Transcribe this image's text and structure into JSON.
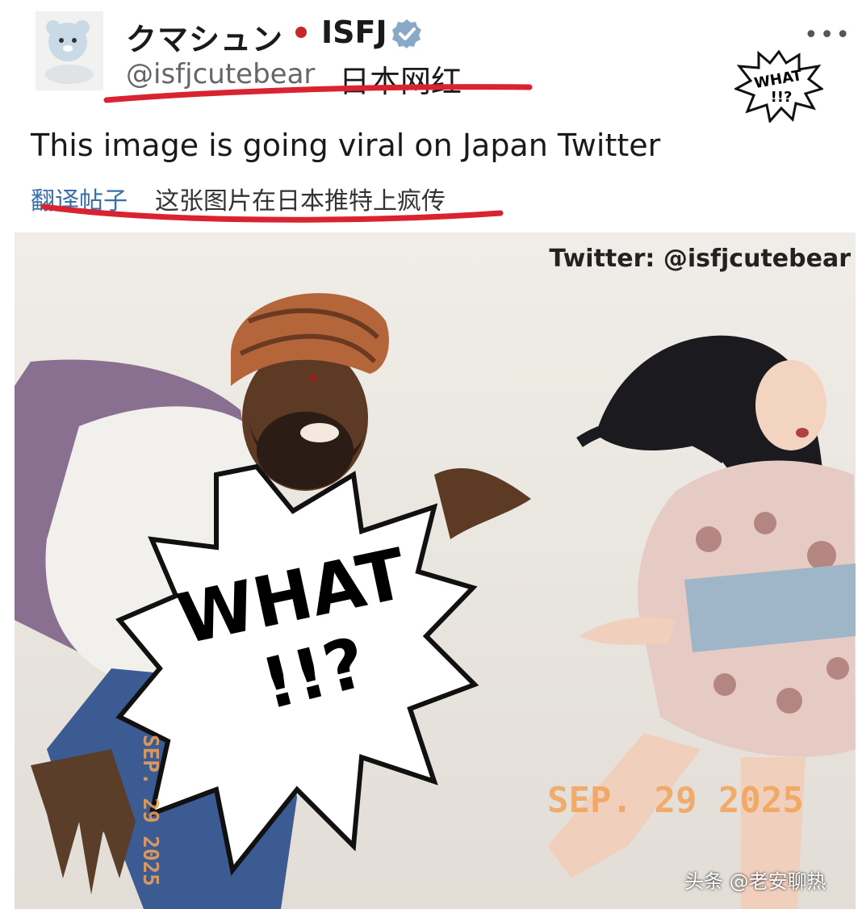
{
  "post": {
    "display_name": "クマシュン",
    "mbti": "ISFJ",
    "handle": "@isfjcutebear",
    "handle_annotation": "日本网红",
    "text": "This image is going viral on Japan Twitter",
    "translate_label": "翻译帖子",
    "translated_text": "这张图片在日本推特上疯传",
    "more_label": "•••"
  },
  "image": {
    "credit": "Twitter: @isfjcutebear",
    "burst_text_line1": "WHAT",
    "burst_text_line2": "!!?",
    "small_burst_line1": "WHAT",
    "small_burst_line2": "!!?",
    "date_stamp": "SEP. 29 2025",
    "date_stamp_vertical": "SEP. 29 2025"
  },
  "watermark": "头条 @老安聊热",
  "colors": {
    "annotation_red": "#d9232e",
    "dot_red": "#c62828",
    "verified_blue": "#8aa9c8",
    "link_blue": "#3a6fa8",
    "date_orange": "#f2a35a"
  }
}
